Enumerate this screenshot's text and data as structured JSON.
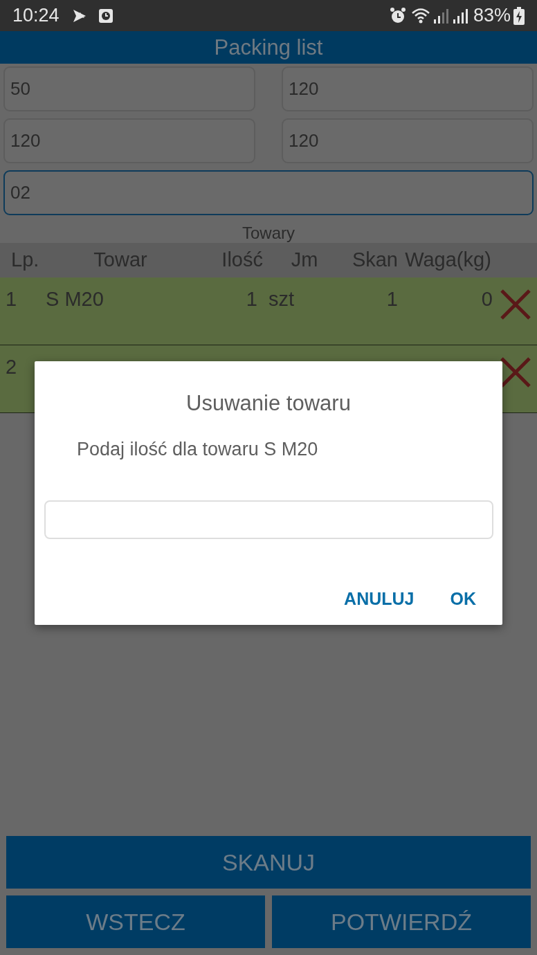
{
  "status_bar": {
    "time": "10:24",
    "battery": "83%"
  },
  "title": "Packing list",
  "fields": [
    {
      "value": "50",
      "focused": false
    },
    {
      "value": "120",
      "focused": false
    },
    {
      "value": "120",
      "focused": false
    },
    {
      "value": "120",
      "focused": false
    },
    {
      "value": "02",
      "focused": true
    }
  ],
  "section_title": "Towary",
  "table": {
    "columns": [
      "Lp.",
      "Towar",
      "Ilość",
      "Jm",
      "Skan",
      "Waga(kg)"
    ],
    "rows": [
      {
        "lp": "1",
        "towar": "S M20",
        "ilosc": "1",
        "jm": "szt",
        "skan": "1",
        "waga": "0"
      },
      {
        "lp": "2"
      }
    ]
  },
  "dialog": {
    "title": "Usuwanie towaru",
    "message": "Podaj ilość dla towaru S M20",
    "buttons": [
      "ANULUJ",
      "OK"
    ]
  },
  "bottom_buttons": [
    "SKANUJ",
    "WSTECZ",
    "POTWIERDŹ"
  ]
}
